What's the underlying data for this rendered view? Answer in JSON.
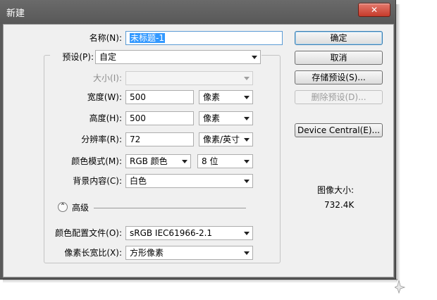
{
  "window": {
    "title": "新建",
    "close_glyph": "✕"
  },
  "form": {
    "name": {
      "label": "名称(N):",
      "value": "未标题-1"
    },
    "preset": {
      "label": "预设(P):",
      "value": "自定"
    },
    "size": {
      "label": "大小(I):",
      "value": ""
    },
    "width": {
      "label": "宽度(W):",
      "value": "500",
      "unit": "像素"
    },
    "height": {
      "label": "高度(H):",
      "value": "500",
      "unit": "像素"
    },
    "resolution": {
      "label": "分辨率(R):",
      "value": "72",
      "unit": "像素/英寸"
    },
    "color_mode": {
      "label": "颜色模式(M):",
      "value": "RGB 颜色",
      "depth": "8 位"
    },
    "background": {
      "label": "背景内容(C):",
      "value": "白色"
    },
    "advanced": {
      "label": "高级",
      "icon_glyph": "⌃"
    },
    "color_profile": {
      "label": "颜色配置文件(O):",
      "value": "sRGB IEC61966-2.1"
    },
    "pixel_aspect": {
      "label": "像素长宽比(X):",
      "value": "方形像素"
    }
  },
  "buttons": {
    "ok": "确定",
    "cancel": "取消",
    "save_preset": "存储预设(S)...",
    "delete_preset": "删除预设(D)...",
    "device_central": "Device Central(E)..."
  },
  "info": {
    "image_size_label": "图像大小:",
    "image_size_value": "732.4K"
  }
}
